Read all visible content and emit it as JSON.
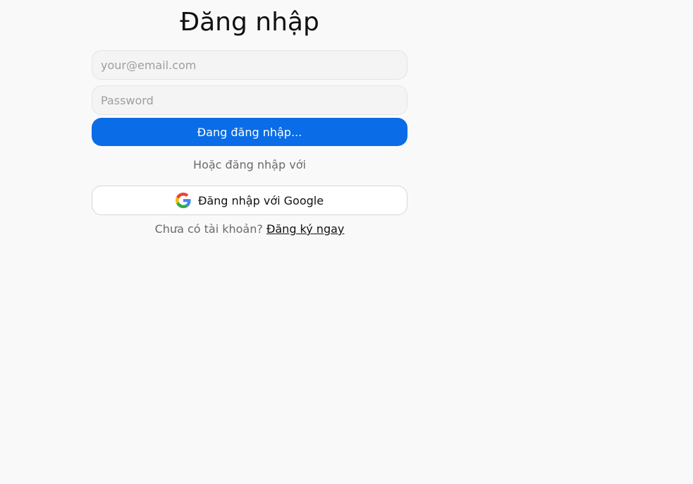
{
  "form": {
    "title": "Đăng nhập",
    "email_placeholder": "your@email.com",
    "email_value": "",
    "password_placeholder": "Password",
    "password_value": "",
    "submit_label": "Đang đăng nhập...",
    "divider_text": "Hoặc đăng nhập với",
    "google_label": "Đăng nhập với Google",
    "google_icon": "google-icon",
    "signup_prompt": "Chưa có tài khoản?",
    "signup_link": "Đăng ký ngay"
  },
  "colors": {
    "background": "#f9f9f9",
    "primary": "#0a6ce6",
    "text": "#111111",
    "muted": "#6b6b6b"
  }
}
